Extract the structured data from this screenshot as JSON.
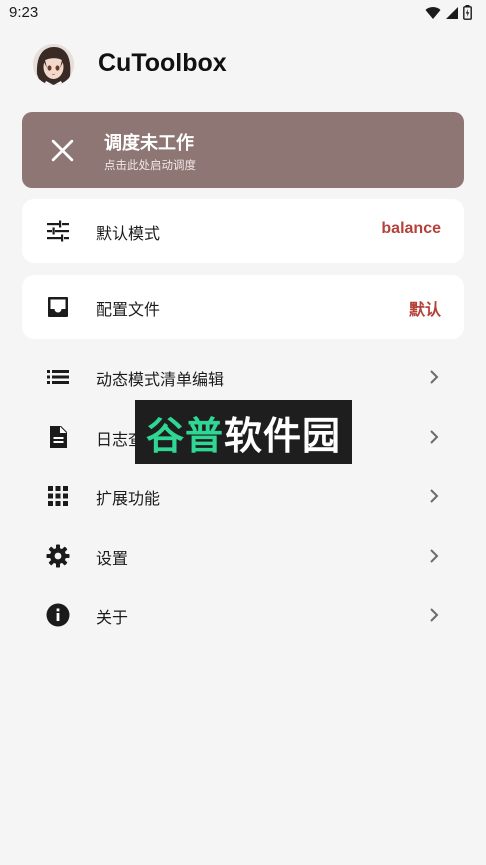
{
  "status_bar": {
    "time": "9:23",
    "icons": [
      "wifi-icon",
      "signal-icon",
      "battery-icon"
    ]
  },
  "header": {
    "title": "CuToolbox",
    "avatar_icon": "avatar-anime-girl"
  },
  "banner": {
    "title": "调度未工作",
    "subtitle": "点击此处启动调度",
    "icon": "close-icon",
    "color": "#8e7674"
  },
  "cards": [
    {
      "label": "默认模式",
      "value": "balance",
      "icon": "tune-sliders-icon"
    },
    {
      "label": "配置文件",
      "value": "默认",
      "icon": "inbox-tray-icon"
    }
  ],
  "menu": [
    {
      "label": "动态模式清单编辑",
      "icon": "list-icon"
    },
    {
      "label": "日志查看",
      "icon": "document-icon"
    },
    {
      "label": "扩展功能",
      "icon": "grid-apps-icon"
    },
    {
      "label": "设置",
      "icon": "gear-icon"
    },
    {
      "label": "关于",
      "icon": "info-icon"
    }
  ],
  "watermark": {
    "text_green": "谷普",
    "text_white": "软件园"
  },
  "colors": {
    "accent_value": "#b5423a",
    "background": "#f5f5f6",
    "watermark_green": "#2fd694"
  }
}
